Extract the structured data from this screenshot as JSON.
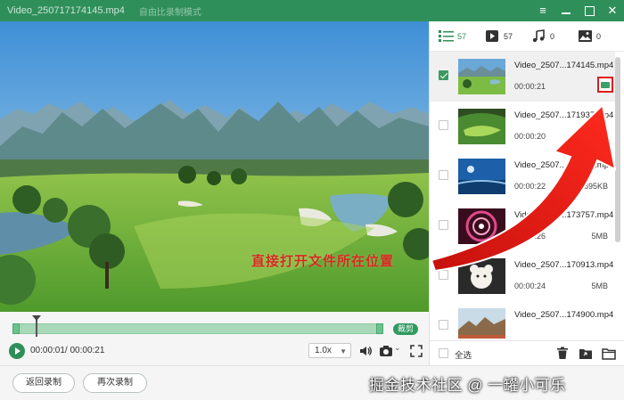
{
  "window": {
    "title": "Video_250717174145.mp4",
    "mode": "自由比录制模式"
  },
  "player": {
    "time": "00:00:01/ 00:00:21",
    "speed": "1.0x",
    "trim_label": "裁剪"
  },
  "annotation": "直接打开文件所在位置",
  "tabs": [
    {
      "icon": "list-icon",
      "count": "57"
    },
    {
      "icon": "video-icon",
      "count": "57"
    },
    {
      "icon": "music-icon",
      "count": "0"
    },
    {
      "icon": "image-icon",
      "count": "0"
    }
  ],
  "files": [
    {
      "name": "Video_2507...174145.mp4",
      "duration": "00:00:21",
      "size": "",
      "selected": true
    },
    {
      "name": "Video_2507...171937.mp4",
      "duration": "00:00:20",
      "size": "",
      "selected": false
    },
    {
      "name": "Video_2507...172850.mp4",
      "duration": "00:00:22",
      "size": "695KB",
      "selected": false
    },
    {
      "name": "Video_2507...173757.mp4",
      "duration": "00:00:26",
      "size": "5MB",
      "selected": false
    },
    {
      "name": "Video_2507...170913.mp4",
      "duration": "00:00:24",
      "size": "5MB",
      "selected": false
    },
    {
      "name": "Video_2507...174900.mp4",
      "duration": "",
      "size": "",
      "selected": false
    }
  ],
  "footer": {
    "select_all": "全选"
  },
  "buttons": {
    "back": "返回录制",
    "record_again": "再次录制"
  },
  "watermark": "掘金技术社区 @ 一罐小可乐",
  "colors": {
    "accent": "#2f8f5a",
    "highlight": "#e01b1b"
  }
}
